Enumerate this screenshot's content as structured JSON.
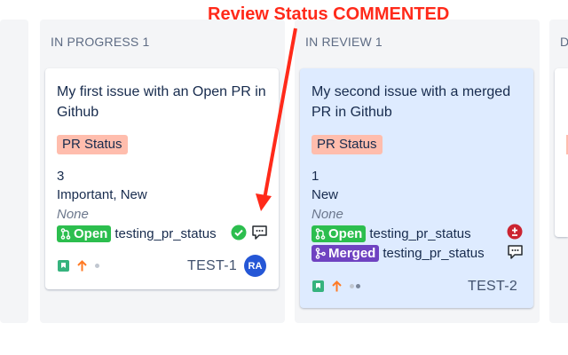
{
  "annotation": {
    "text": "Review Status COMMENTED",
    "color": "#ff2a1a"
  },
  "columns": [
    {
      "name": "IN PROGRESS",
      "count": "1"
    },
    {
      "name": "IN REVIEW",
      "count": "1"
    },
    {
      "name": "D"
    }
  ],
  "cards": [
    {
      "title": "My first issue with an Open PR in Github",
      "pr_field_label": "PR Status",
      "story_points": "3",
      "labels": "Important, New",
      "fix_version": "None",
      "prs": [
        {
          "state": "Open",
          "branch": "testing_pr_status",
          "review": "approved",
          "comment": true
        }
      ],
      "key": "TEST-1",
      "assignee_initials": "RA",
      "issue_type_icon": "story-icon",
      "priority_icon": "arrow-up-icon"
    },
    {
      "title": "My second issue with a merged PR in Github",
      "pr_field_label": "PR Status",
      "story_points": "1",
      "labels": "New",
      "fix_version": "None",
      "prs": [
        {
          "state": "Open",
          "branch": "testing_pr_status",
          "review": "changes-requested"
        },
        {
          "state": "Merged",
          "branch": "testing_pr_status",
          "review": "commented"
        }
      ],
      "key": "TEST-2",
      "issue_type_icon": "story-icon",
      "priority_icon": "arrow-up-icon"
    }
  ],
  "colors": {
    "open": "#2cbe4e",
    "merged": "#6f42c1",
    "approved": "#2cbe4e",
    "changes_requested": "#cb2431",
    "pr_pill": "#ffbdad",
    "highlight_card": "#deebff",
    "avatar": "#2557d6"
  }
}
